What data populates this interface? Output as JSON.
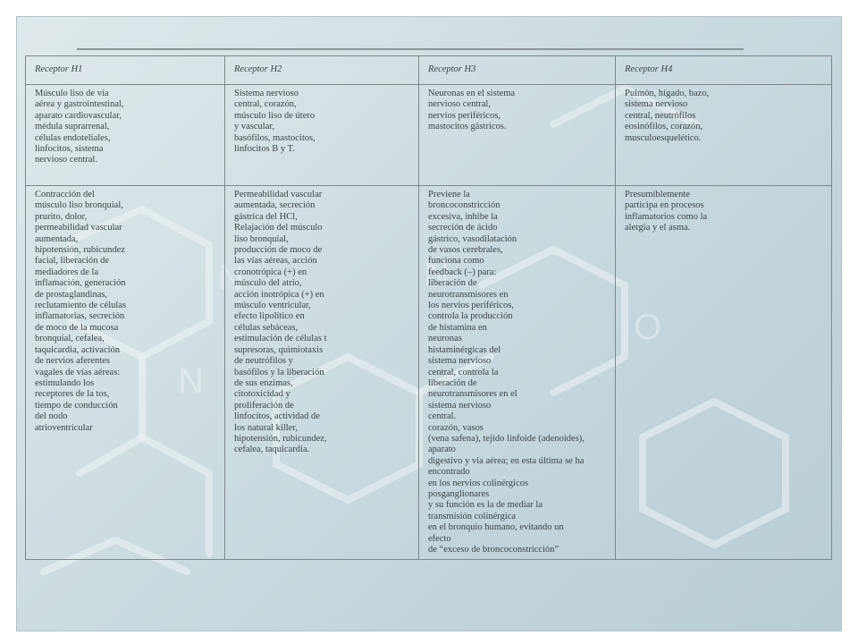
{
  "table": {
    "headers": [
      "Receptor H1",
      "Receptor H2",
      "Receptor H3",
      "Receptor H4"
    ],
    "rows": [
      [
        [
          "Músculo liso de vía",
          "aérea y gastrointestinal,",
          "aparato cardiovascular,",
          "médula suprarrenal,",
          "células endoteliales,",
          "linfocitos, sistema",
          "nervioso central."
        ],
        [
          "Sistema nervioso",
          "central, corazón,",
          "músculo liso de útero",
          "y vascular,",
          "basófilos, mastocitos,",
          "linfocitos B y T."
        ],
        [
          "Neuronas en el sistema",
          "nervioso central,",
          "nervios periféricos,",
          "mastocitos gástricos."
        ],
        [
          "Pulmón, hígado, bazo,",
          "sistema nervioso",
          "central, neutrófilos",
          "eosinófilos, corazón,",
          "musculoesquelético."
        ]
      ],
      [
        [
          "Contracción del",
          "músculo liso bronquial,",
          "prurito, dolor,",
          "permeabilidad  vascular",
          "aumentada,",
          "hipotensión, rubicundez",
          "facial, liberación de",
          "mediadores de la",
          "inflamación, generación",
          "de prostaglandinas,",
          "reclutamiento de células",
          "inflamatorias, secreción",
          "de moco de la mucosa",
          "bronquial, cefalea,",
          "taquicardia, activación",
          "de nervios aferentes",
          "vagales de vías aéreas:",
          "estimulando los",
          "receptores de la tos,",
          "tiempo de conducción",
          "del nodo",
          "atrioventricular"
        ],
        [
          "Permeabilidad vascular",
          "aumentada, secreción",
          "gástrica del HCl,",
          "Relajación del músculo",
          "liso bronquial,",
          "producción de moco de",
          "las vías aéreas, acción",
          "cronotrópica (+) en",
          "músculo del atrio,",
          "acción inotrópica (+) en",
          "músculo ventricular,",
          "efecto lipolítico en",
          "células sebáceas,",
          "estimulación de células t",
          "supresoras, quimiotaxis",
          "de neutrófilos y",
          "basófilos y la liberación",
          "de sus enzimas,",
          "citotoxicidad y",
          "proliferación de",
          "linfocitos, actividad de",
          "los natural killer,",
          "hipotensión, rubicundez,",
          "cefalea, taquicardia."
        ],
        [
          "Previene la",
          "broncoconstricción",
          "excesiva, inhibe la",
          "secreción de ácido",
          "gástrico, vasodilatación",
          "de vasos cerebrales,",
          "funciona como",
          "feedback (–) para:",
          "liberación de",
          "neurotransmisores en",
          "los nervios periféricos,",
          "controla la producción",
          "de histamina en",
          "neuronas",
          "histaminérgicas del",
          "sistema nervioso",
          "central, controla la",
          "liberación de",
          "neurotransmisores en el",
          "sistema nervioso",
          "central.",
          "corazón, vasos",
          "(vena safena), tejido linfoide (adenoides),",
          "aparato",
          "digestivo y vía aérea; en esta última se ha",
          "encontrado",
          "en los nervios colinérgicos",
          "posganglionares",
          "y su función es la de mediar la",
          "transmisión colinérgica",
          "en el bronquio humano, evitando un",
          "efecto",
          "de “exceso de broncoconstricción”"
        ],
        [
          "Presumiblemente",
          "participa en procesos",
          "inflamatorios como la",
          "alergia y el asma."
        ]
      ]
    ]
  }
}
